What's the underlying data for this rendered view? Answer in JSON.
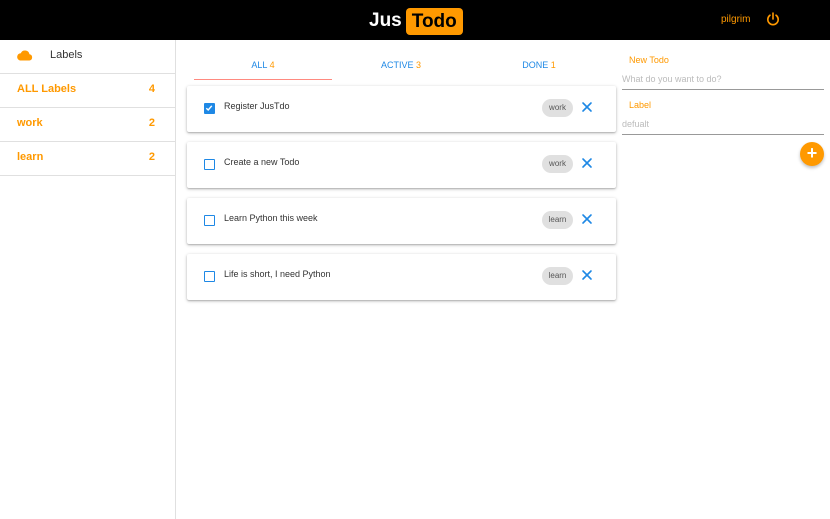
{
  "header": {
    "logo_part1": "Jus",
    "logo_part2": "Todo",
    "username": "pilgrim",
    "power_icon": "power-icon"
  },
  "sidebar": {
    "title": "Labels",
    "icon": "cloud-icon",
    "items": [
      {
        "label": "ALL Labels",
        "count": "4"
      },
      {
        "label": "work",
        "count": "2"
      },
      {
        "label": "learn",
        "count": "2"
      }
    ]
  },
  "tabs": [
    {
      "label": "ALL",
      "count": "4",
      "active": true
    },
    {
      "label": "ACTIVE",
      "count": "3",
      "active": false
    },
    {
      "label": "DONE",
      "count": "1",
      "active": false
    }
  ],
  "todos": [
    {
      "text": "Register JusTdo",
      "label": "work",
      "done": true
    },
    {
      "text": "Create a new Todo",
      "label": "work",
      "done": false
    },
    {
      "text": "Learn Python this week",
      "label": "learn",
      "done": false
    },
    {
      "text": "Life is short, I need Python",
      "label": "learn",
      "done": false
    }
  ],
  "form": {
    "todo_label": "New Todo",
    "todo_placeholder": "What do you want to do?",
    "label_label": "Label",
    "label_placeholder": "defualt",
    "add_icon": "plus"
  },
  "colors": {
    "accent": "#ff9900",
    "primary": "#1e88e5",
    "header_bg": "#000000",
    "tab_underline": "#ff8a80"
  }
}
